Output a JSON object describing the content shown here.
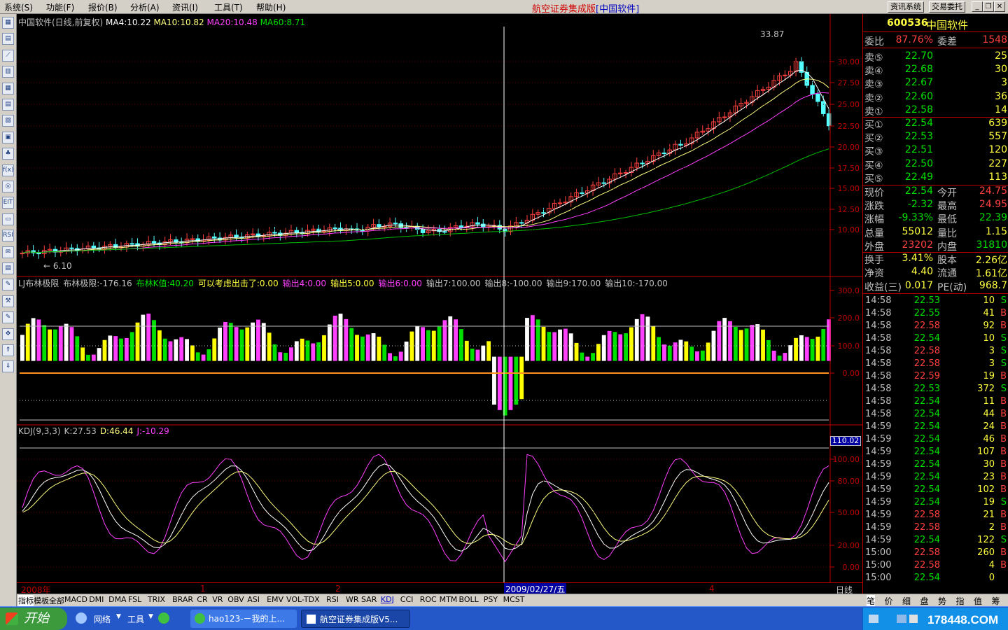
{
  "menu": [
    "系统(S)",
    "功能(F)",
    "报价(B)",
    "分析(A)",
    "资讯(I)",
    "工具(T)",
    "帮助(H)"
  ],
  "app_title": "航空证券集成版",
  "app_subtitle": "[中国软件]",
  "top_buttons": [
    "资讯系统",
    "交易委托"
  ],
  "left_toolbar": [
    "▦",
    "▤",
    "⟋",
    "▥",
    "▦",
    "▤",
    "▧",
    "▣",
    "♣",
    "f(x)",
    "◎",
    "EIT",
    "▭",
    "RSI",
    "✉",
    "▤",
    "✎",
    "⚒",
    "✎",
    "✥",
    "⇑",
    "⇓"
  ],
  "price_panel": {
    "header": {
      "title": "中国软件(日线,前复权)",
      "ma4": "MA4:10.22",
      "ma10": "MA10:10.82",
      "ma20": "MA20:10.48",
      "ma60": "MA60:8.71"
    },
    "high_label": "33.87",
    "low_label": "6.10",
    "y_ticks": [
      "30.00",
      "27.50",
      "25.00",
      "22.50",
      "20.00",
      "17.50",
      "15.00",
      "12.50",
      "10.00"
    ]
  },
  "ind_panel": {
    "parts": [
      {
        "t": "LJ布林极限",
        "c": "#c0c0c0"
      },
      {
        "t": "布林极限:-176.16",
        "c": "#c0c0c0"
      },
      {
        "t": "布林K值:40.20",
        "c": "#00e000"
      },
      {
        "t": "可以考虑出击了:0.00",
        "c": "#ffff40"
      },
      {
        "t": "输出4:0.00",
        "c": "#ff40ff"
      },
      {
        "t": "输出5:0.00",
        "c": "#ffff40"
      },
      {
        "t": "输出6:0.00",
        "c": "#ff40ff"
      },
      {
        "t": "输出7:100.00",
        "c": "#c0c0c0"
      },
      {
        "t": "输出8:-100.00",
        "c": "#c0c0c0"
      },
      {
        "t": "输出9:170.00",
        "c": "#c0c0c0"
      },
      {
        "t": "输出10:-170.00",
        "c": "#c0c0c0"
      }
    ],
    "y_ticks": [
      "300.0",
      "200.0",
      "100.0",
      "0.00"
    ]
  },
  "kdj_panel": {
    "parts": [
      {
        "t": "KDJ(9,3,3)",
        "c": "#c0c0c0"
      },
      {
        "t": "K:27.53",
        "c": "#c0c0c0"
      },
      {
        "t": "D:46.44",
        "c": "#ffff80"
      },
      {
        "t": "J:-10.29",
        "c": "#ff40ff"
      }
    ],
    "y_ticks": [
      "100.00",
      "80.00",
      "50.00",
      "20.00",
      "0.00"
    ],
    "cursor_value": "110.02"
  },
  "x_axis": {
    "year": "2008年",
    "m1": "1",
    "m2": "2",
    "m4": "4",
    "cursor_date": "2009/02/27/五",
    "period": "日线"
  },
  "quote": {
    "code": "600536",
    "name": "中国软件",
    "wb": {
      "l1": "委比",
      "v1": "87.76%",
      "l2": "委差",
      "v2": "1548"
    },
    "asks": [
      {
        "l": "卖⑤",
        "p": "22.70",
        "v": "25"
      },
      {
        "l": "卖④",
        "p": "22.68",
        "v": "30"
      },
      {
        "l": "卖③",
        "p": "22.67",
        "v": "3"
      },
      {
        "l": "卖②",
        "p": "22.60",
        "v": "36"
      },
      {
        "l": "卖①",
        "p": "22.58",
        "v": "14"
      }
    ],
    "bids": [
      {
        "l": "买①",
        "p": "22.54",
        "v": "639"
      },
      {
        "l": "买②",
        "p": "22.53",
        "v": "557"
      },
      {
        "l": "买③",
        "p": "22.51",
        "v": "120"
      },
      {
        "l": "买④",
        "p": "22.50",
        "v": "227"
      },
      {
        "l": "买⑤",
        "p": "22.49",
        "v": "113"
      }
    ],
    "stats": [
      {
        "l1": "现价",
        "v1": "22.54",
        "c1": "#00e000",
        "l2": "今开",
        "v2": "24.75",
        "c2": "#ff4040"
      },
      {
        "l1": "涨跌",
        "v1": "-2.32",
        "c1": "#00e000",
        "l2": "最高",
        "v2": "24.95",
        "c2": "#ff4040"
      },
      {
        "l1": "涨幅",
        "v1": "-9.33%",
        "c1": "#00e000",
        "l2": "最低",
        "v2": "22.39",
        "c2": "#00e000"
      },
      {
        "l1": "总量",
        "v1": "55012",
        "c1": "#ffff40",
        "l2": "量比",
        "v2": "1.15",
        "c2": "#ffff40"
      },
      {
        "l1": "外盘",
        "v1": "23202",
        "c1": "#ff4040",
        "l2": "内盘",
        "v2": "31810",
        "c2": "#00e000"
      },
      {
        "l1": "换手",
        "v1": "3.41%",
        "c1": "#ffff40",
        "l2": "股本",
        "v2": "2.26亿",
        "c2": "#ffff40"
      },
      {
        "l1": "净资",
        "v1": "4.40",
        "c1": "#ffff40",
        "l2": "流通",
        "v2": "1.61亿",
        "c2": "#ffff40"
      },
      {
        "l1": "收益(三)",
        "v1": "0.017",
        "c1": "#ffff40",
        "l2": "PE(动)",
        "v2": "968.7",
        "c2": "#ffff40"
      }
    ],
    "ticks": [
      {
        "t": "14:58",
        "p": "22.53",
        "v": "10",
        "d": "S"
      },
      {
        "t": "14:58",
        "p": "22.55",
        "v": "41",
        "d": "B"
      },
      {
        "t": "14:58",
        "p": "22.58",
        "v": "92",
        "d": "B"
      },
      {
        "t": "14:58",
        "p": "22.54",
        "v": "10",
        "d": "S"
      },
      {
        "t": "14:58",
        "p": "22.58",
        "v": "3",
        "d": "S"
      },
      {
        "t": "14:58",
        "p": "22.58",
        "v": "3",
        "d": "S"
      },
      {
        "t": "14:58",
        "p": "22.59",
        "v": "19",
        "d": "B"
      },
      {
        "t": "14:58",
        "p": "22.53",
        "v": "372",
        "d": "S"
      },
      {
        "t": "14:58",
        "p": "22.54",
        "v": "11",
        "d": "B"
      },
      {
        "t": "14:58",
        "p": "22.54",
        "v": "44",
        "d": "B"
      },
      {
        "t": "14:59",
        "p": "22.54",
        "v": "24",
        "d": "B"
      },
      {
        "t": "14:59",
        "p": "22.54",
        "v": "46",
        "d": "B"
      },
      {
        "t": "14:59",
        "p": "22.54",
        "v": "107",
        "d": "B"
      },
      {
        "t": "14:59",
        "p": "22.54",
        "v": "30",
        "d": "B"
      },
      {
        "t": "14:59",
        "p": "22.54",
        "v": "23",
        "d": "B"
      },
      {
        "t": "14:59",
        "p": "22.54",
        "v": "102",
        "d": "B"
      },
      {
        "t": "14:59",
        "p": "22.54",
        "v": "19",
        "d": "S"
      },
      {
        "t": "14:59",
        "p": "22.58",
        "v": "21",
        "d": "B"
      },
      {
        "t": "14:59",
        "p": "22.58",
        "v": "2",
        "d": "B"
      },
      {
        "t": "14:59",
        "p": "22.54",
        "v": "122",
        "d": "S"
      },
      {
        "t": "15:00",
        "p": "22.58",
        "v": "260",
        "d": "B"
      },
      {
        "t": "15:00",
        "p": "22.58",
        "v": "4",
        "d": "B"
      },
      {
        "t": "15:00",
        "p": "22.54",
        "v": "0",
        "d": ""
      }
    ]
  },
  "bottom_tabs": [
    "指标",
    "模板",
    "全部",
    "MACD",
    "DMI",
    "DMA",
    "FSL",
    "TRIX",
    "BRAR",
    "CR",
    "VR",
    "OBV",
    "ASI",
    "EMV",
    "VOL-TDX",
    "RSI",
    "WR",
    "SAR",
    "KDJ",
    "CCI",
    "ROC",
    "MTM",
    "BOLL",
    "PSY",
    "MCST"
  ],
  "active_tab": "KDJ",
  "right_tabs": [
    "笔",
    "价",
    "细",
    "盘",
    "势",
    "指",
    "值",
    "筹"
  ],
  "taskbar": {
    "start": "开始",
    "quick": [
      "网络",
      "工具"
    ],
    "tasks": [
      "hao123-－我的上...",
      "航空证券集成版V5..."
    ],
    "watermark": "178448.COM"
  },
  "colors": {
    "up": "#ff4040",
    "down": "#54ffff",
    "ma4": "#ffffff",
    "ma10": "#ffff80",
    "ma20": "#ff40ff",
    "ma60": "#00c000"
  }
}
